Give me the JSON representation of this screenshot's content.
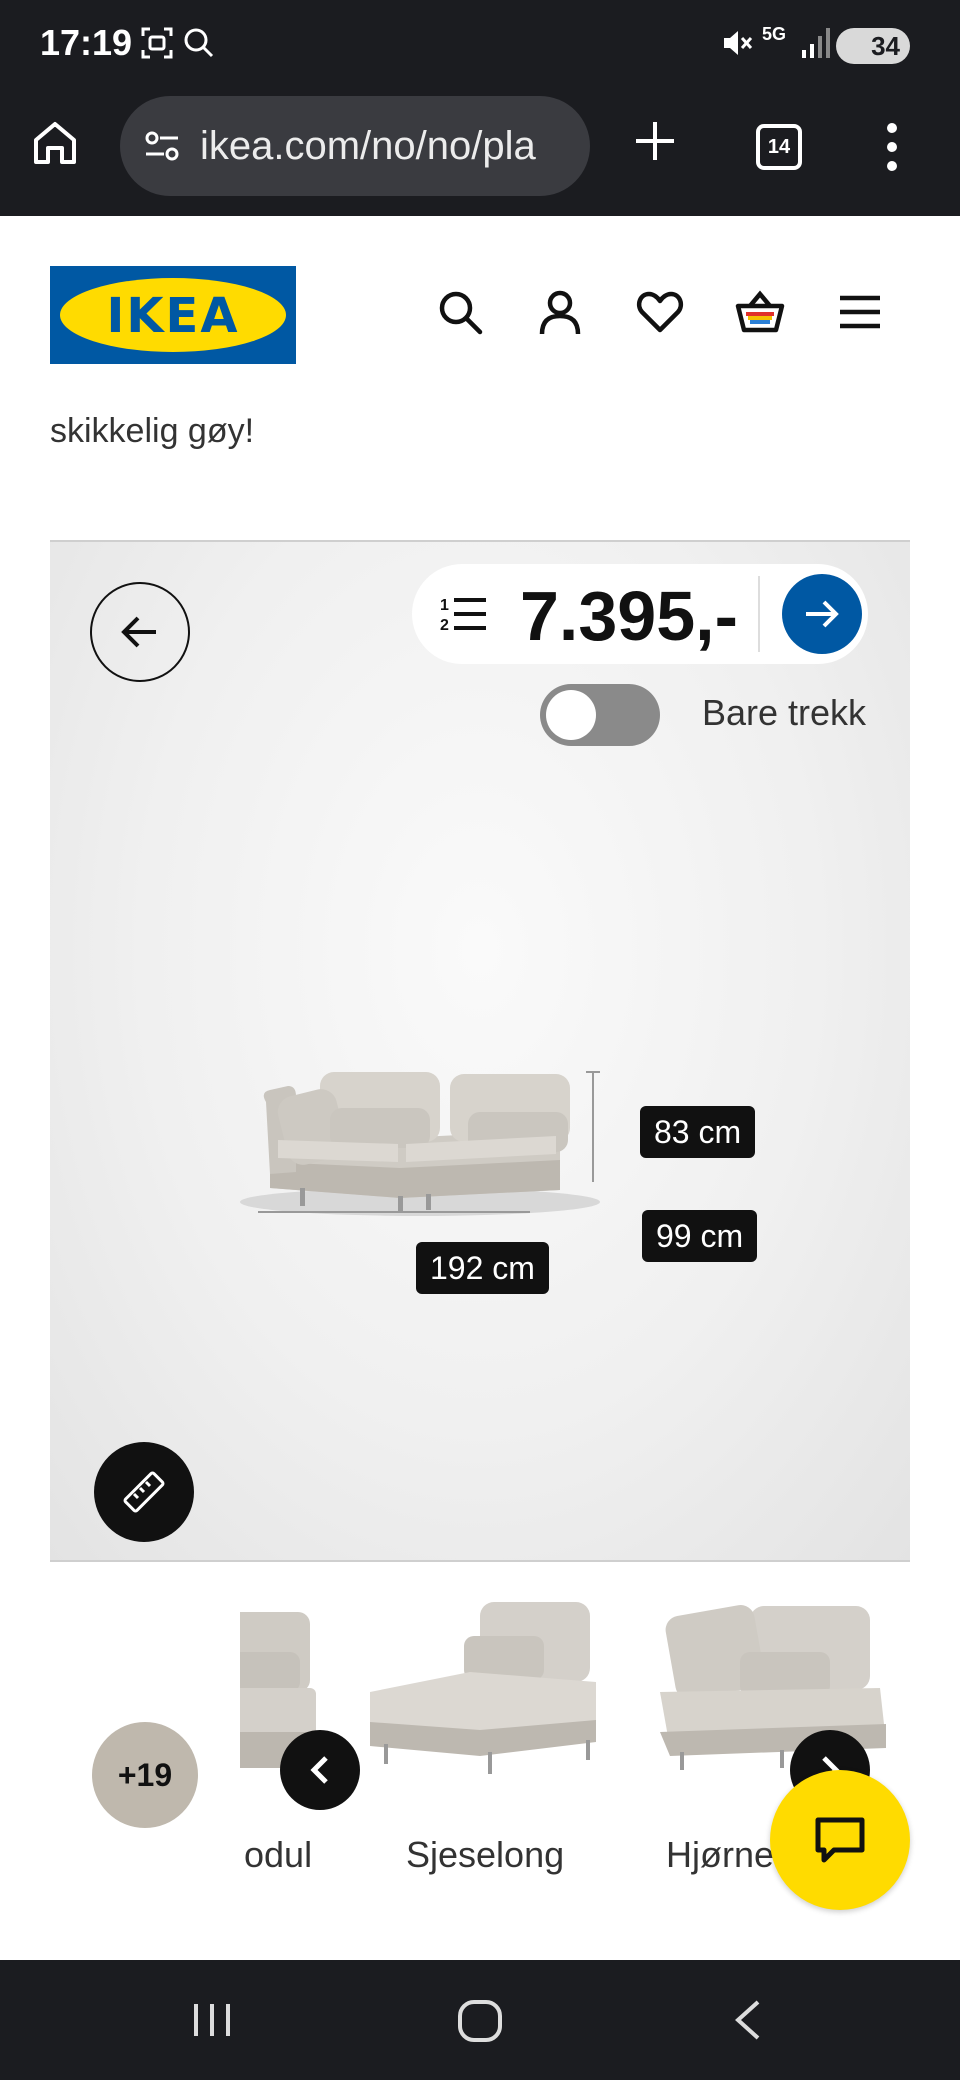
{
  "status_bar": {
    "time": "17:19",
    "battery": "34",
    "network": "5G",
    "icons": [
      "screenshot-icon",
      "search-icon",
      "mute-icon",
      "5g-icon",
      "signal-icon",
      "battery-icon"
    ]
  },
  "browser": {
    "url": "ikea.com/no/no/pla",
    "tab_count": "14",
    "icons": [
      "home-icon",
      "site-settings-icon",
      "new-tab-icon",
      "tabs-icon",
      "menu-icon"
    ]
  },
  "header": {
    "logo_text": "IKEA",
    "icons": [
      "search-icon",
      "account-icon",
      "heart-icon",
      "basket-icon",
      "hamburger-icon"
    ],
    "colors": {
      "brand_blue": "#0058a3",
      "brand_yellow": "#ffdb00"
    }
  },
  "tagline": "skikkelig gøy!",
  "viewer": {
    "price": "7.395,-",
    "toggle_label": "Bare trekk",
    "toggle_on": false,
    "dimensions": {
      "height": "83 cm",
      "depth": "99 cm",
      "width": "192 cm"
    }
  },
  "carousel": {
    "more_count": "+19",
    "items": [
      {
        "label": "odul"
      },
      {
        "label": "Sjeselong"
      },
      {
        "label": "Hjørne"
      }
    ]
  },
  "navbar": {
    "icons": [
      "recents-icon",
      "home-icon",
      "back-icon"
    ]
  }
}
